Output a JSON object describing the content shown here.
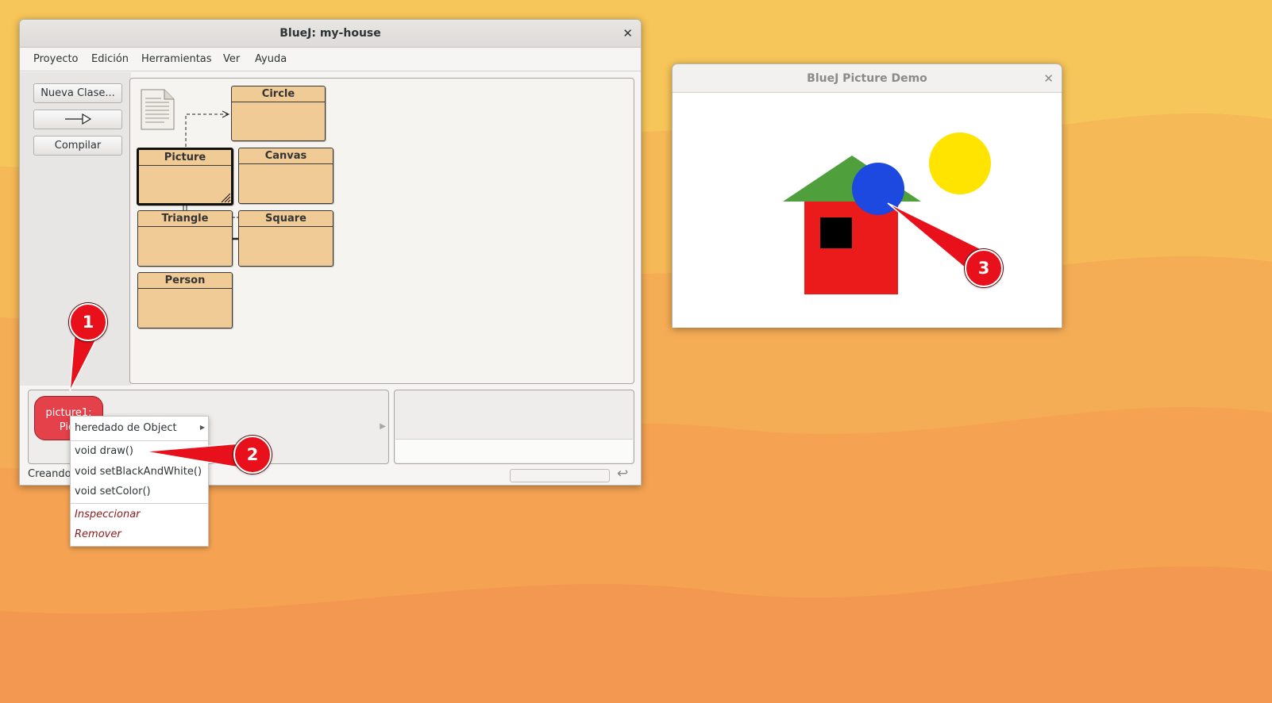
{
  "main_window": {
    "title": "BlueJ: my-house",
    "menu": [
      "Proyecto",
      "Edición",
      "Herramientas",
      "Ver",
      "Ayuda"
    ],
    "buttons": {
      "new_class": "Nueva Clase...",
      "compile": "Compilar"
    },
    "classes": {
      "circle": "Circle",
      "picture": "Picture",
      "canvas": "Canvas",
      "triangle": "Triangle",
      "square": "Square",
      "person": "Person"
    },
    "object_bench": {
      "instance_line1": "picture1:",
      "instance_line2": "Pict"
    },
    "status": "Creando"
  },
  "context_menu": {
    "inherited": "heredado de Object",
    "items": [
      "void draw()",
      "void setBlackAndWhite()",
      "void setColor()"
    ],
    "inspect": "Inspeccionar",
    "remove": "Remover"
  },
  "demo_window": {
    "title": "BlueJ Picture Demo"
  },
  "callouts": [
    "1",
    "2",
    "3"
  ],
  "colors": {
    "class_fill": "#f0cb96",
    "instance_fill": "#e4414a",
    "callout_red": "#e8111b",
    "wall": "#ec1b1b",
    "window": "#000000",
    "roof": "#4f9f3c",
    "blue_circle": "#1e49e0",
    "sun": "#ffe400"
  },
  "icons": [
    "close-icon",
    "document-icon",
    "arrow-icon",
    "submenu-arrow-icon",
    "scroll-arrow-icon",
    "return-icon"
  ]
}
